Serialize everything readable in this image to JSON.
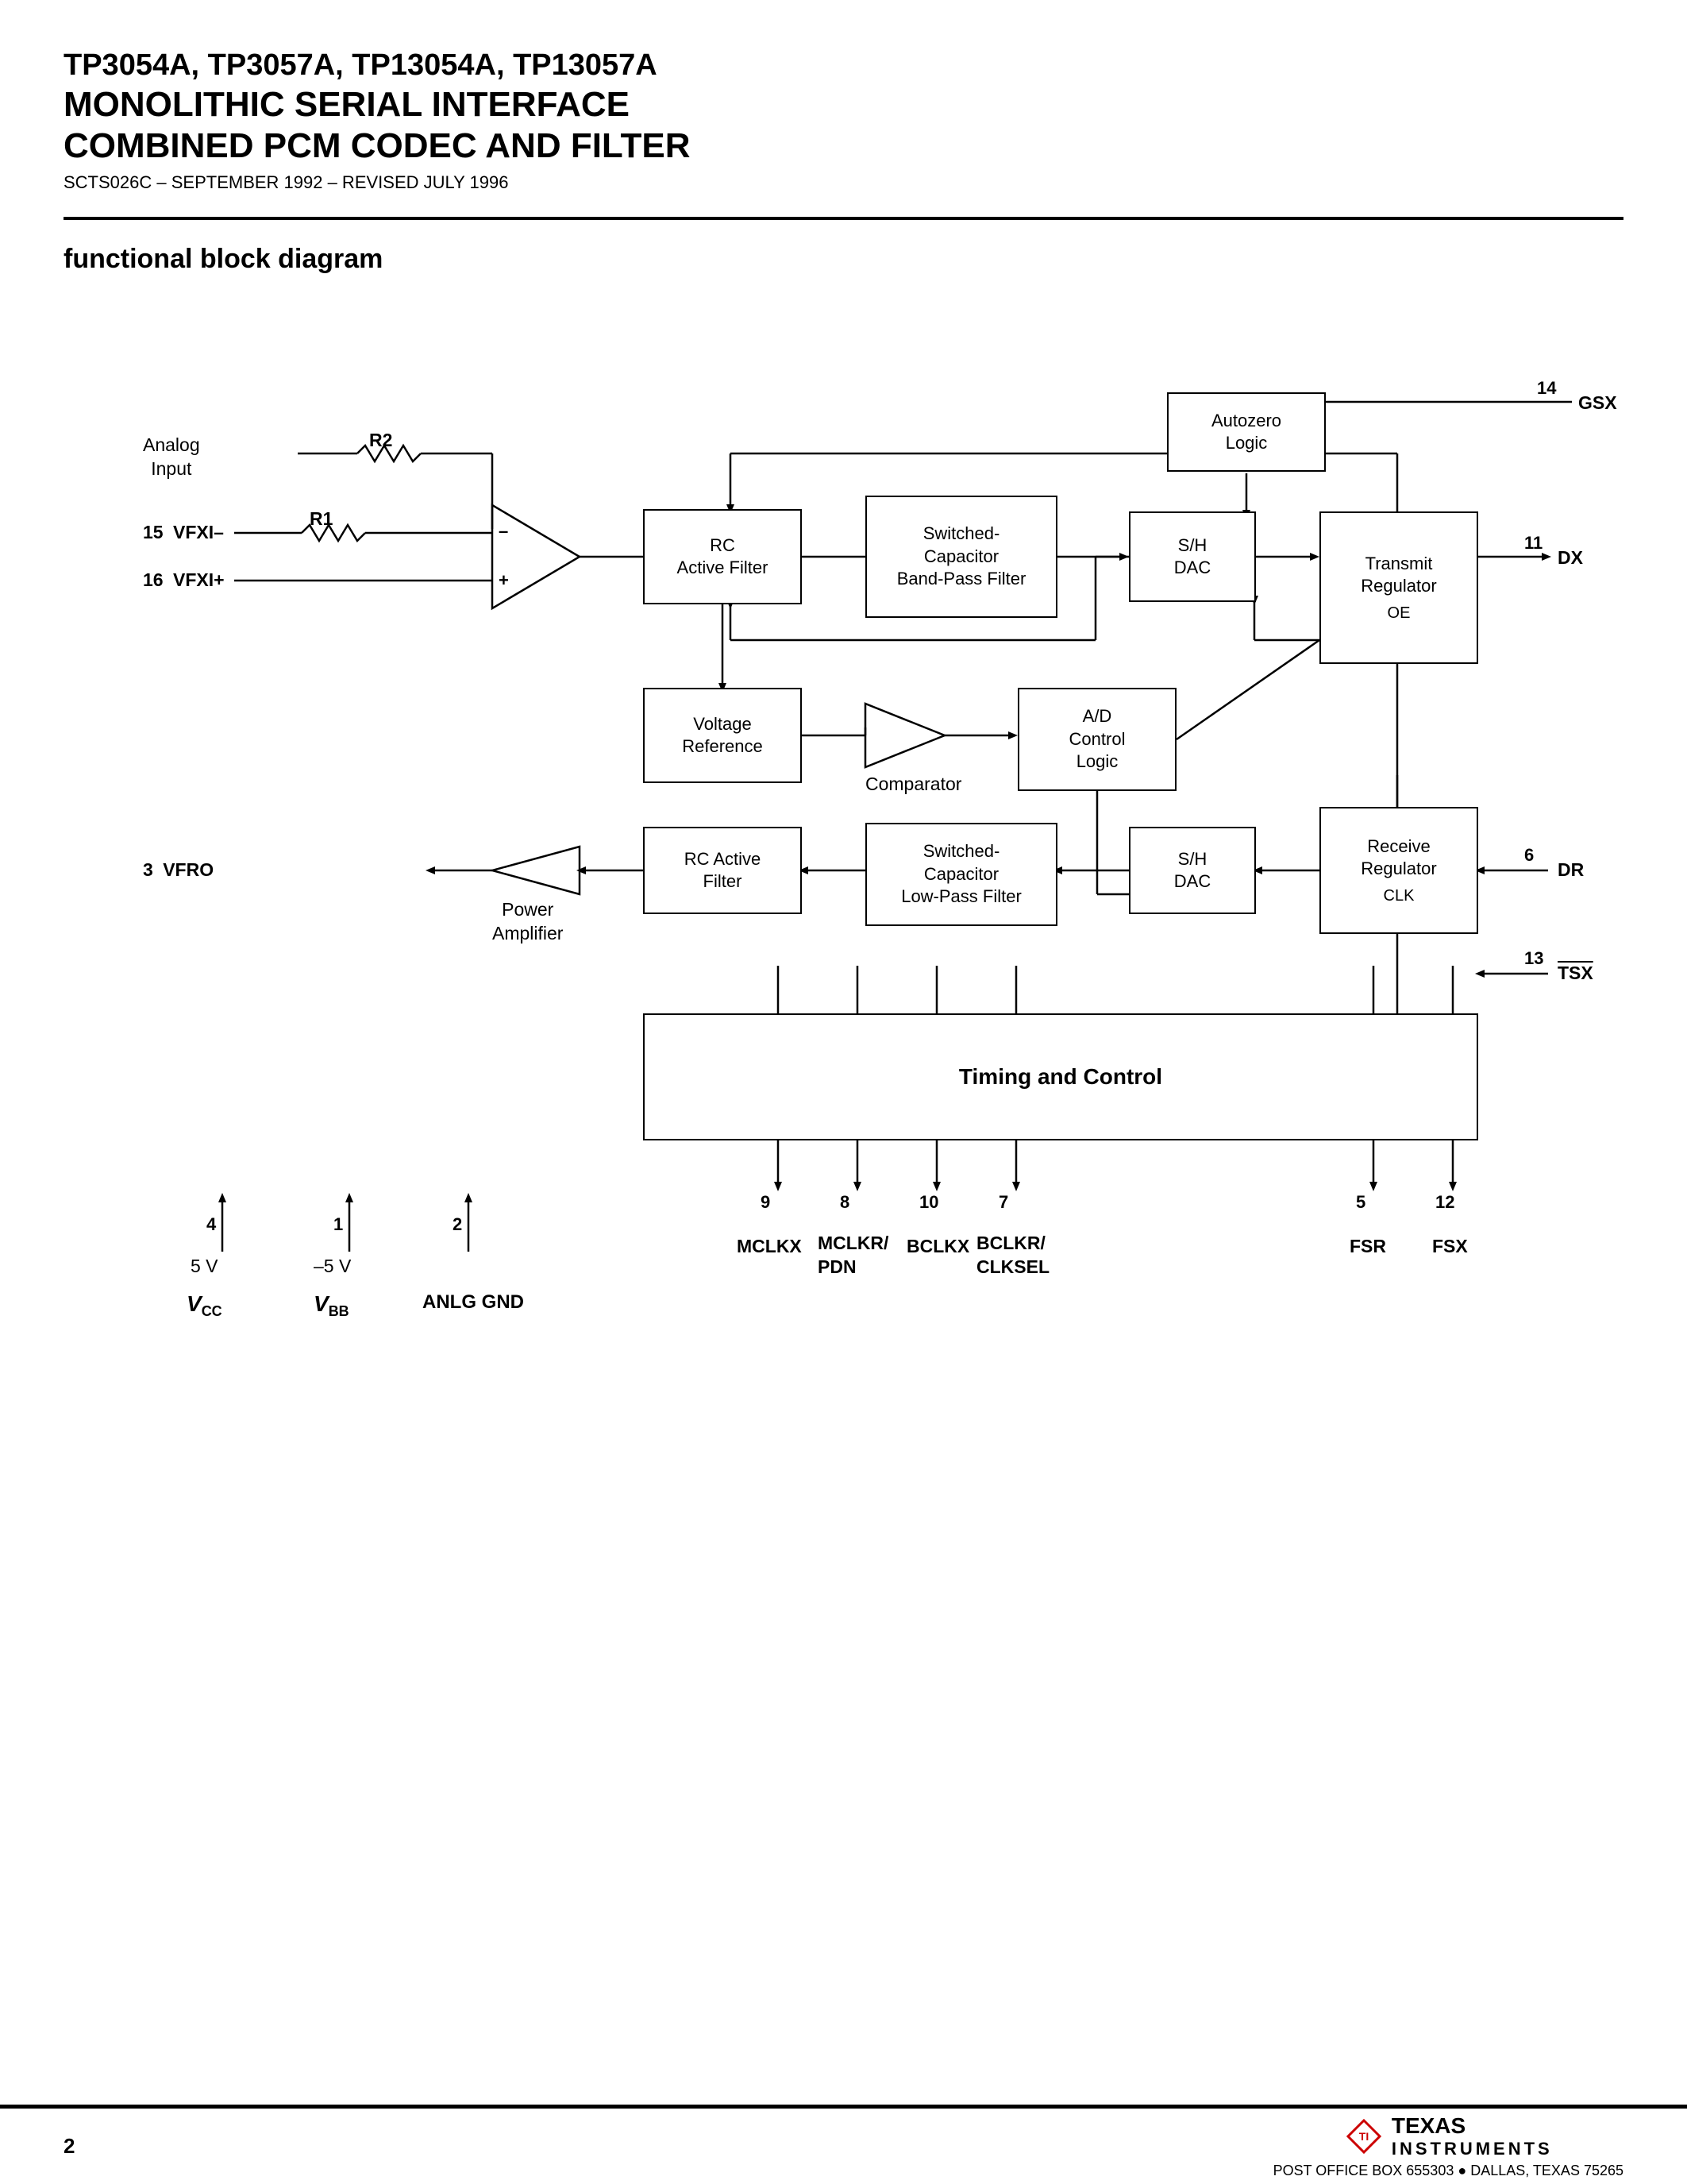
{
  "header": {
    "line1": "TP3054A, TP3057A, TP13054A, TP13057A",
    "line2": "MONOLITHIC SERIAL INTERFACE",
    "line3": "COMBINED PCM CODEC AND FILTER",
    "subtitle": "SCTS026C – SEPTEMBER 1992 – REVISED JULY 1996"
  },
  "section": {
    "title": "functional block diagram"
  },
  "blocks": {
    "autozero_logic": "Autozero\nLogic",
    "rc_active_filter_top": "RC\nActive Filter",
    "switched_cap_bpf": "Switched-\nCapacitor\nBand-Pass Filter",
    "sh_dac_top": "S/H\nDAC",
    "voltage_reference": "Voltage\nReference",
    "ad_control_logic": "A/D\nControl\nLogic",
    "transmit_regulator": "Transmit\nRegulator",
    "transmit_oe": "OE",
    "rc_active_filter_bot": "RC Active\nFilter",
    "switched_cap_lpf": "Switched-\nCapacitor\nLow-Pass Filter",
    "sh_dac_bot": "S/H\nDAC",
    "receive_regulator": "Receive\nRegulator",
    "receive_clk": "CLK",
    "timing_control": "Timing and Control"
  },
  "labels": {
    "analog_input": "Analog\nInput",
    "vfxi_minus": "VFXI–",
    "vfxi_plus": "VFXI+",
    "vfro": "VFRO",
    "comparator": "Comparator",
    "power_amplifier": "Power\nAmplifier",
    "vcc": "V",
    "vcc_sub": "CC",
    "vbb": "V",
    "vbb_sub": "BB",
    "anlg_gnd": "ANLG GND",
    "five_v": "5 V",
    "neg_five_v": "–5 V"
  },
  "pins": {
    "r2": "R2",
    "r1": "R1",
    "pin15": "15",
    "pin16": "16",
    "pin14": "14",
    "pin11": "11",
    "pin6": "6",
    "pin13": "13",
    "pin3": "3",
    "pin4": "4",
    "pin1": "1",
    "pin2": "2",
    "pin9": "9",
    "pin8": "8",
    "pin10": "10",
    "pin7": "7",
    "pin5": "5",
    "pin12": "12"
  },
  "signals": {
    "gsx": "GSX",
    "dx": "DX",
    "dr": "DR",
    "tsx": "TSX",
    "mclkx": "MCLKX",
    "mclkr_pdn": "MCLKR/\nPDN",
    "bclkx": "BCLKX",
    "bclkr_clksel": "BCLKR/\nCLKSEL",
    "fsr": "FSR",
    "fsx": "FSX"
  },
  "footer": {
    "page_num": "2",
    "ti_name": "TEXAS",
    "ti_instruments": "INSTRUMENTS",
    "address": "POST OFFICE BOX 655303 ● DALLAS, TEXAS 75265"
  }
}
